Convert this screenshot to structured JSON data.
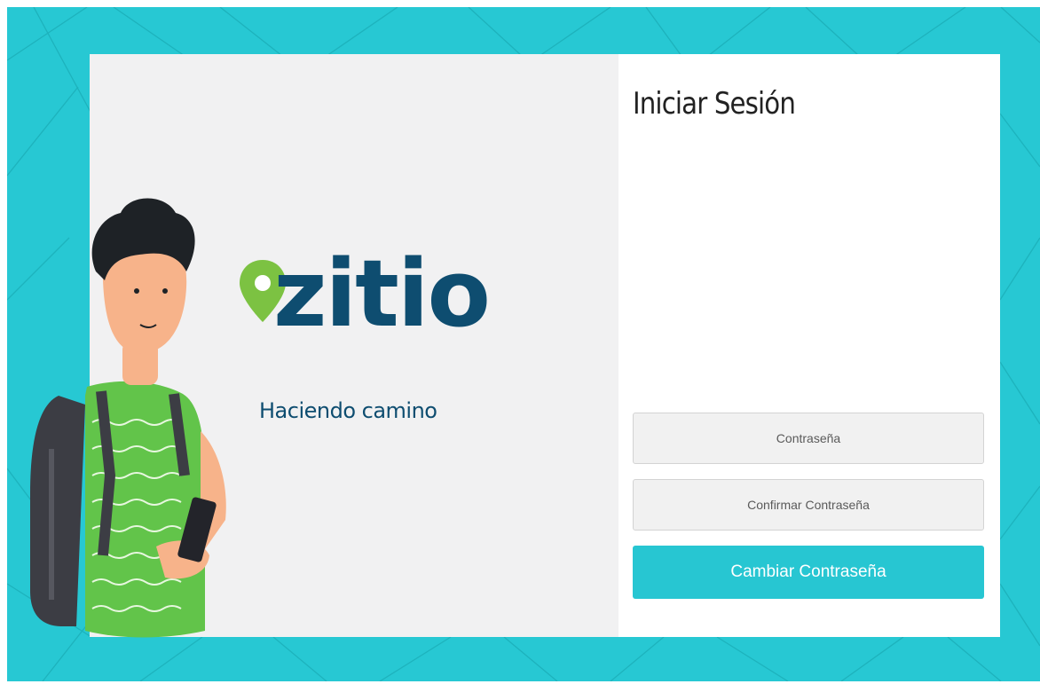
{
  "login": {
    "title": "Iniciar Sesión",
    "password_placeholder": "Contraseña",
    "confirm_placeholder": "Confirmar Contraseña",
    "submit_label": "Cambiar Contraseña"
  },
  "brand": {
    "name": "zitio",
    "tagline": "Haciendo camino"
  },
  "icons": [
    "map-pin-icon"
  ],
  "colors": {
    "background": "#27c8d3",
    "accent_button": "#27c6d2",
    "brand_dark": "#0e4d70",
    "pin_green": "#7cc242",
    "left_panel": "#f1f1f2"
  }
}
